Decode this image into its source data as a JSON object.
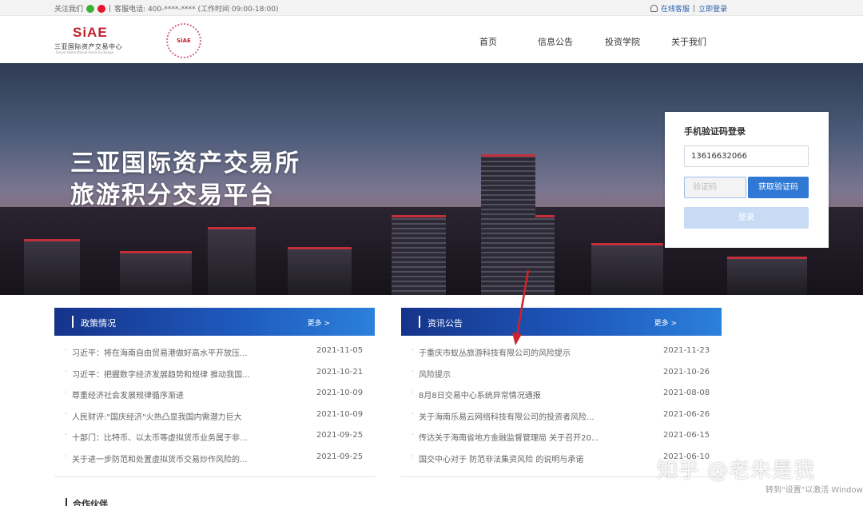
{
  "topbar": {
    "follow_label": "关注我们",
    "separator": "|",
    "hotline": "客服电话: 400-****-**** (工作时间 09:00-18:00)",
    "online_service": "在线客服",
    "login_link": "立即登录"
  },
  "header": {
    "logo_mark": "SiAE",
    "logo_cn": "三亚国际资产交易中心",
    "logo_en": "Sanya International Asset Exchange",
    "seal_text": "SiAE",
    "nav": [
      "首页",
      "信息公告",
      "投资学院",
      "关于我们"
    ]
  },
  "banner": {
    "line1": "三亚国际资产交易所",
    "line2": "旅游积分交易平台"
  },
  "login": {
    "title": "手机验证码登录",
    "phone_value": "13616632066",
    "code_placeholder": "验证码",
    "get_code_label": "获取验证码",
    "submit_label": "登录"
  },
  "policy": {
    "title": "政策情况",
    "more": "更多 >",
    "items": [
      {
        "title": "习近平：将在海南自由贸易港做好高水平开放压...",
        "date": "2021-11-05"
      },
      {
        "title": "习近平：把握数字经济发展趋势和规律 推动我国...",
        "date": "2021-10-21"
      },
      {
        "title": "尊重经济社会发展规律循序渐进",
        "date": "2021-10-09"
      },
      {
        "title": "人民财评:\"国庆经济\"火热凸显我国内需潜力巨大",
        "date": "2021-10-09"
      },
      {
        "title": "十部门：比特币、以太币等虚拟货币业务属于非...",
        "date": "2021-09-25"
      },
      {
        "title": "关于进一步防范和处置虚拟货币交易炒作风险的...",
        "date": "2021-09-25"
      }
    ]
  },
  "news": {
    "title": "资讯公告",
    "more": "更多 >",
    "items": [
      {
        "title": "于重庆市蚁丛旅游科技有限公司的风险提示",
        "date": "2021-11-23"
      },
      {
        "title": "风险提示",
        "date": "2021-10-26"
      },
      {
        "title": "8月8日交易中心系统异常情况通报",
        "date": "2021-08-08"
      },
      {
        "title": "关于海南乐易云网络科技有限公司的投资者风险...",
        "date": "2021-06-26"
      },
      {
        "title": "传达关于海南省地方金融监督管理局 关于召开20...",
        "date": "2021-06-15"
      },
      {
        "title": "国交中心对于 防范非法集资风险 的说明与承诺",
        "date": "2021-06-10"
      }
    ]
  },
  "partner_title": "合作伙伴",
  "watermark": "知乎 @老朱是我",
  "activate_text": "转到\"设置\"以激活 Windows",
  "colors": {
    "brand_red": "#c41f2f",
    "panel_blue": "#1f5cc0",
    "button_blue": "#2f78d4",
    "arrow_red": "#d0222a"
  }
}
